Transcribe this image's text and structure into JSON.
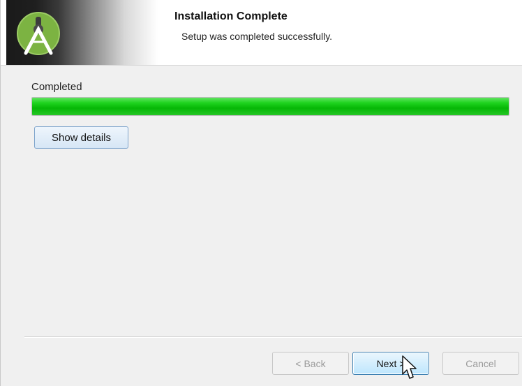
{
  "header": {
    "title": "Installation Complete",
    "subtitle": "Setup was completed successfully.",
    "logo_icon": "android-studio-logo-icon"
  },
  "status": {
    "label": "Completed",
    "progress_fraction": 1.0,
    "progress_color": "#1ed31e"
  },
  "buttons": {
    "show_details": "Show details",
    "back": "< Back",
    "next": "Next >",
    "cancel": "Cancel"
  },
  "cursor_icon": "mouse-pointer-icon"
}
